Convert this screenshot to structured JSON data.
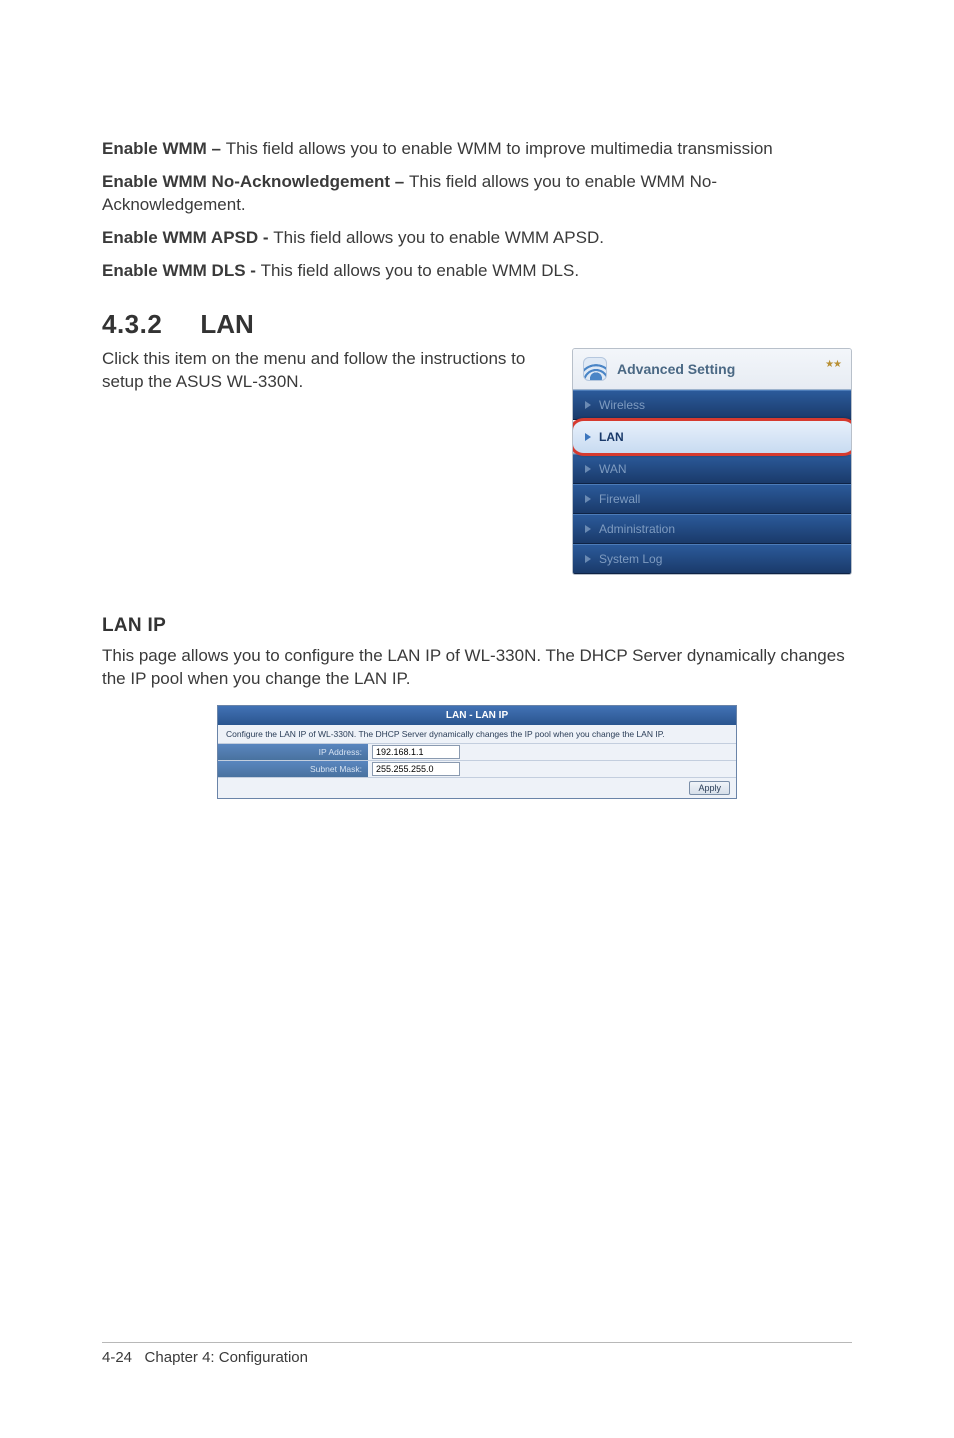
{
  "definitions": [
    {
      "term": "Enable WMM – ",
      "desc": "This field allows you to enable WMM to improve multimedia transmission"
    },
    {
      "term": "Enable WMM No-Acknowledgement – ",
      "desc": "This field allows you to enable WMM No-Acknowledgement."
    },
    {
      "term": "Enable WMM APSD - ",
      "desc": "This field allows you to enable WMM APSD."
    },
    {
      "term": "Enable WMM DLS - ",
      "desc": "This field allows you to enable WMM DLS."
    }
  ],
  "section": {
    "number": "4.3.2",
    "title": "LAN",
    "intro": "Click this item on the menu and follow the instructions to setup the ASUS WL-330N."
  },
  "menu": {
    "header_title": "Advanced Setting",
    "items": [
      {
        "label": "Wireless",
        "active": false
      },
      {
        "label": "LAN",
        "active": true
      },
      {
        "label": "WAN",
        "active": false
      },
      {
        "label": "Firewall",
        "active": false
      },
      {
        "label": "Administration",
        "active": false
      },
      {
        "label": "System Log",
        "active": false
      }
    ]
  },
  "lanip": {
    "heading": "LAN IP",
    "desc_para": "This page allows you to configure the LAN IP of WL-330N. The DHCP Server dynamically changes the IP pool when you change the LAN IP.",
    "panel_title": "LAN - LAN IP",
    "panel_desc": "Configure the LAN IP of WL-330N. The DHCP Server dynamically changes the IP pool when you change the LAN IP.",
    "rows": [
      {
        "label": "IP Address:",
        "value": "192.168.1.1"
      },
      {
        "label": "Subnet Mask:",
        "value": "255.255.255.0"
      }
    ],
    "apply_label": "Apply"
  },
  "footer": {
    "page": "4-24",
    "chapter": "Chapter 4: Configuration"
  }
}
